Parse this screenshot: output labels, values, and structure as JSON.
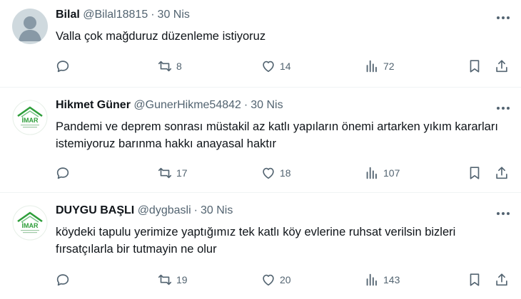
{
  "tweets": [
    {
      "name": "Bilal",
      "handle": "@Bilal18815",
      "dot": "·",
      "date": "30 Nis",
      "text": "Valla çok mağduruz düzenleme istiyoruz",
      "replies": "",
      "retweets": "8",
      "likes": "14",
      "views": "72",
      "avatar": "default-avatar"
    },
    {
      "name": "Hikmet Güner",
      "handle": "@GunerHikme54842",
      "dot": "·",
      "date": "30 Nis",
      "text": "Pandemi ve deprem sonrası müstakil az katlı yapıların önemi artarken yıkım kararları istemiyoruz barınma hakkı anayasal haktır",
      "replies": "",
      "retweets": "17",
      "likes": "18",
      "views": "107",
      "avatar": "imar-logo",
      "avatar_text": "İMAR"
    },
    {
      "name": "DUYGU BAŞLI",
      "handle": "@dygbasli",
      "dot": "·",
      "date": "30 Nis",
      "text": "köydeki tapulu yerimize yaptığımız tek katlı köy evlerine ruhsat verilsin bizleri fırsatçılarla bir tutmayin ne olur",
      "replies": "",
      "retweets": "19",
      "likes": "20",
      "views": "143",
      "avatar": "imar-logo",
      "avatar_text": "İMAR"
    }
  ],
  "colors": {
    "text": "#0f1419",
    "muted": "#536471",
    "divider": "#eff3f4",
    "logo_green": "#2e9e3a"
  }
}
